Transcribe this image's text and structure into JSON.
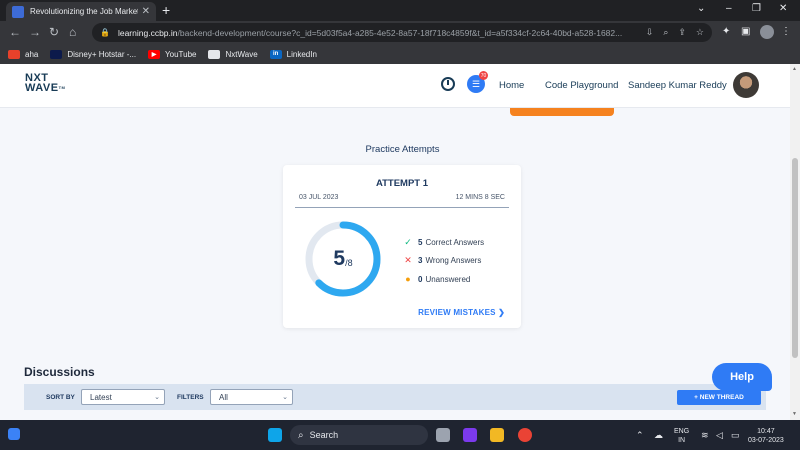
{
  "browser": {
    "tab_title": "Revolutionizing the Job Market |",
    "url_host": "learning.ccbp.in",
    "url_path": "/backend-development/course?c_id=5d03f5a4-a285-4e52-8a57-18f718c4859f&t_id=a5f334cf-2c64-40bd-a528-1682...",
    "bookmarks": [
      {
        "label": "aha",
        "icon": "aha-icon",
        "color": "#e8412b"
      },
      {
        "label": "Disney+ Hotstar -...",
        "icon": "hotstar-icon",
        "color": "#0c1a4b"
      },
      {
        "label": "YouTube",
        "icon": "youtube-icon",
        "color": "#ff0000"
      },
      {
        "label": "NxtWave",
        "icon": "nxtwave-icon",
        "color": "#e5e7eb"
      },
      {
        "label": "LinkedIn",
        "icon": "linkedin-icon",
        "color": "#0a66c2"
      }
    ]
  },
  "header": {
    "logo_line1": "NXT",
    "logo_line2": "WAVE",
    "logo_tm": "TM",
    "chat_badge": "70",
    "nav_home": "Home",
    "nav_playground": "Code Playground",
    "user_name": "Sandeep Kumar Reddy"
  },
  "practice": {
    "title": "Practice Attempts",
    "attempt": {
      "title": "ATTEMPT 1",
      "date": "03 JUL 2023",
      "duration": "12 MINS 8 SEC",
      "score": "5",
      "total": "/8",
      "score_fraction": 0.625,
      "correct_count": "5",
      "correct_label": "Correct Answers",
      "wrong_count": "3",
      "wrong_label": "Wrong Answers",
      "unanswered_count": "0",
      "unanswered_label": "Unanswered",
      "review_label": "REVIEW MISTAKES ❯"
    }
  },
  "discussions": {
    "title": "Discussions",
    "sort_label": "SORT BY",
    "sort_value": "Latest",
    "filters_label": "FILTERS",
    "filter_value": "All",
    "new_thread_label": "+ NEW THREAD"
  },
  "help_label": "Help",
  "taskbar": {
    "search_label": "Search",
    "lang_line1": "ENG",
    "lang_line2": "IN",
    "time": "10:47",
    "date": "03-07-2023"
  },
  "colors": {
    "accent": "#2f7bf5",
    "donut_fill": "#2ea8f0",
    "donut_track": "#e2e8f0",
    "correct": "#10b981",
    "wrong": "#ef4444",
    "unanswered": "#f59e0b"
  }
}
